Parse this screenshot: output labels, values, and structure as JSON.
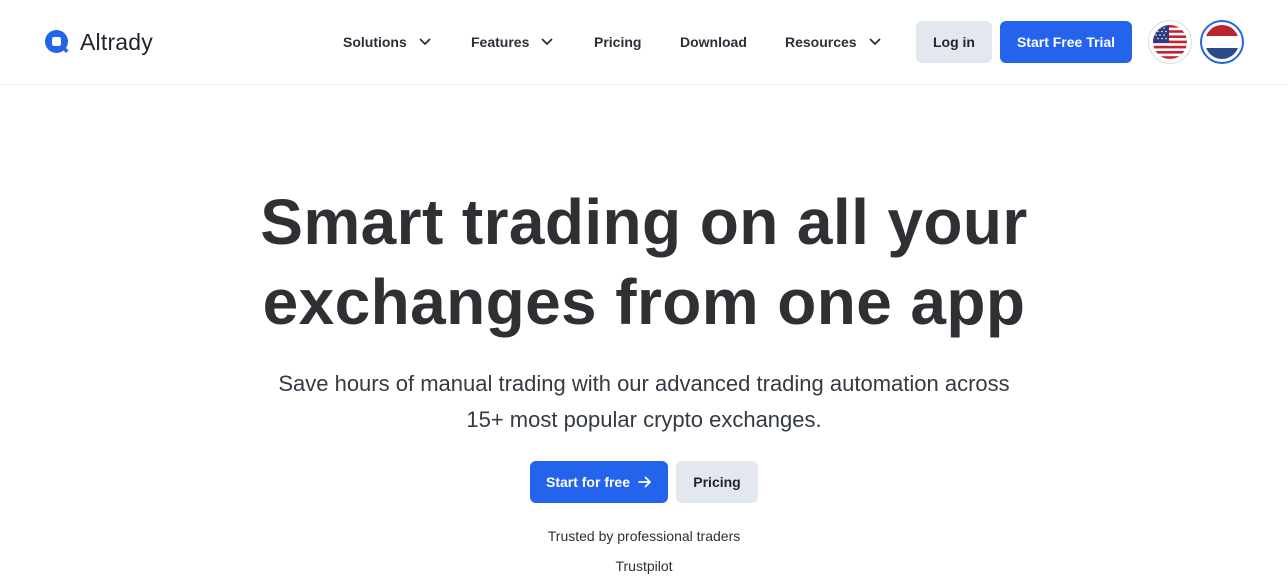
{
  "brand": {
    "name": "Altrady",
    "accent": "#2463eb"
  },
  "nav": {
    "items": [
      {
        "label": "Solutions",
        "has_dropdown": true
      },
      {
        "label": "Features",
        "has_dropdown": true
      },
      {
        "label": "Pricing",
        "has_dropdown": false
      },
      {
        "label": "Download",
        "has_dropdown": false
      },
      {
        "label": "Resources",
        "has_dropdown": true
      }
    ]
  },
  "header_actions": {
    "login_label": "Log in",
    "trial_label": "Start Free Trial",
    "languages": [
      {
        "code": "en",
        "icon": "us-flag-icon",
        "selected": false
      },
      {
        "code": "nl",
        "icon": "nl-flag-icon",
        "selected": true
      }
    ]
  },
  "hero": {
    "title_line1": "Smart trading on all your",
    "title_line2": "exchanges from one app",
    "subtitle_line1": "Save hours of manual trading with our advanced trading automation across",
    "subtitle_line2": "15+ most popular crypto exchanges.",
    "primary_cta": "Start for free",
    "secondary_cta": "Pricing",
    "trusted_text": "Trusted by professional traders",
    "trustpilot_text": "Trustpilot"
  }
}
